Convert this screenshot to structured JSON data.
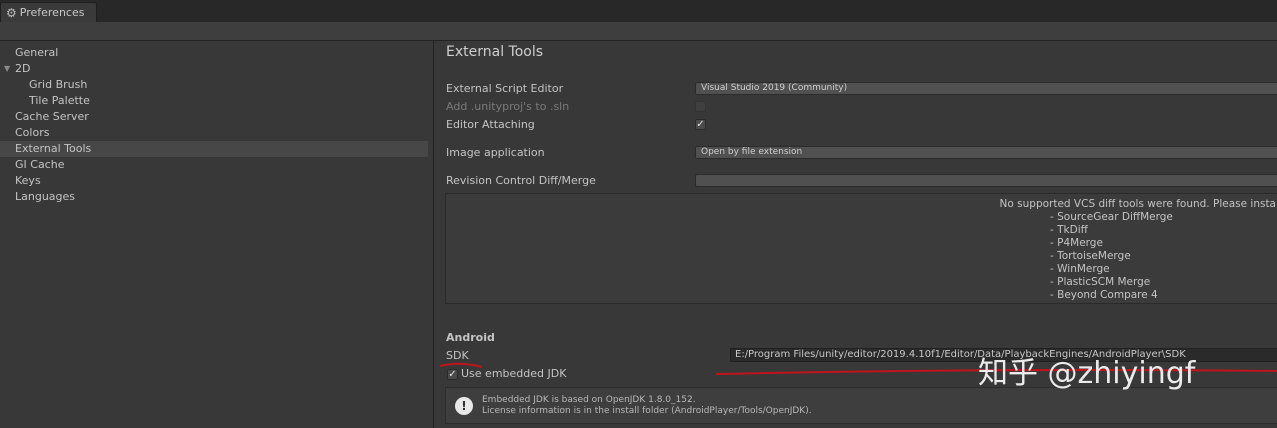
{
  "window": {
    "tab_title": "Preferences"
  },
  "sidebar": {
    "items": [
      {
        "label": "General"
      },
      {
        "label": "2D"
      },
      {
        "label": "Grid Brush"
      },
      {
        "label": "Tile Palette"
      },
      {
        "label": "Cache Server"
      },
      {
        "label": "Colors"
      },
      {
        "label": "External Tools"
      },
      {
        "label": "GI Cache"
      },
      {
        "label": "Keys"
      },
      {
        "label": "Languages"
      }
    ],
    "selected": "External Tools"
  },
  "main": {
    "title": "External Tools",
    "script_editor_label": "External Script Editor",
    "script_editor_value": "Visual Studio 2019 (Community)",
    "unityproj_label": "Add .unityproj's to .sln",
    "editor_attaching_label": "Editor Attaching",
    "editor_attaching_checked": true,
    "image_app_label": "Image application",
    "image_app_value": "Open by file extension",
    "revision_label": "Revision Control Diff/Merge",
    "revision_value": "",
    "vcs_message": "No supported VCS diff tools were found. Please insta",
    "vcs_tools": [
      "- SourceGear DiffMerge",
      "- TkDiff",
      "- P4Merge",
      "- TortoiseMerge",
      "- WinMerge",
      "- PlasticSCM Merge",
      "- Beyond Compare 4"
    ]
  },
  "android": {
    "heading": "Android",
    "sdk_label": "SDK",
    "sdk_path": "E:/Program Files/unity/editor/2019.4.10f1/Editor/Data/PlaybackEngines/AndroidPlayer\\SDK",
    "embedded_jdk_label": "Use embedded JDK",
    "embedded_jdk_checked": true,
    "help_line1": "Embedded JDK is based on OpenJDK 1.8.0_152.",
    "help_line2": "License information is in the install folder (AndroidPlayer/Tools/OpenJDK)."
  },
  "watermark": "知乎 @zhiyingf",
  "colors": {
    "background": "#383838",
    "annotation": "#c0141c"
  }
}
